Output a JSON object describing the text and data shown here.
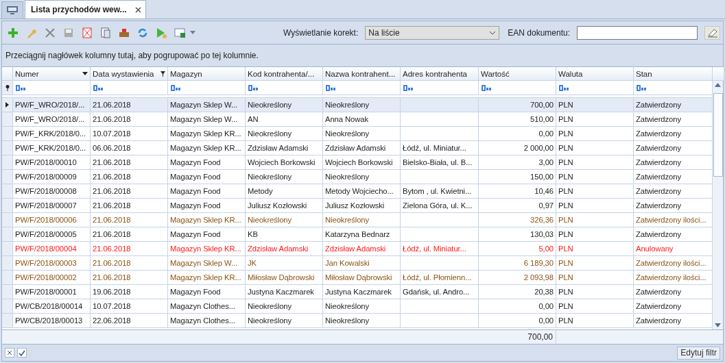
{
  "tabs": [
    {
      "label": "Lista przychodów wew...",
      "selected": true
    }
  ],
  "toolbar": {
    "corrections_label": "Wyświetlanie korekt:",
    "corrections_value": "Na liście",
    "ean_label": "EAN dokumentu:"
  },
  "group_hint": "Przeciągnij nagłówek kolumny tutaj, aby pogrupować po tej kolumnie.",
  "table": {
    "columns": [
      {
        "label": "Numer",
        "sorted": true,
        "filtered": false,
        "kind": "text"
      },
      {
        "label": "Data wystawienia",
        "sorted": false,
        "filtered": true,
        "kind": "text"
      },
      {
        "label": "Magazyn",
        "sorted": false,
        "filtered": false,
        "kind": "text"
      },
      {
        "label": "Kod kontrahenta/...",
        "sorted": false,
        "filtered": false,
        "kind": "text"
      },
      {
        "label": "Nazwa kontrahent...",
        "sorted": false,
        "filtered": false,
        "kind": "text"
      },
      {
        "label": "Adres kontrahenta",
        "sorted": false,
        "filtered": false,
        "kind": "text"
      },
      {
        "label": "Wartość",
        "sorted": false,
        "filtered": false,
        "kind": "amount"
      },
      {
        "label": "Waluta",
        "sorted": false,
        "filtered": false,
        "kind": "text"
      },
      {
        "label": "Stan",
        "sorted": false,
        "filtered": false,
        "kind": "text"
      }
    ],
    "rows": [
      {
        "selected": true,
        "kind": "normal",
        "cells": [
          "PW/F_WRO/2018/...",
          "21.06.2018",
          "Magazyn Sklep W...",
          "Nieokreślony",
          "Nieokreślony",
          "",
          "700,00",
          "PLN",
          "Zatwierdzony"
        ]
      },
      {
        "selected": false,
        "kind": "normal",
        "cells": [
          "PW/F_WRO/2018/...",
          "21.06.2018",
          "Magazyn Sklep W...",
          "AN",
          "Anna Nowak",
          "",
          "510,00",
          "PLN",
          "Zatwierdzony"
        ]
      },
      {
        "selected": false,
        "kind": "normal",
        "cells": [
          "PW/F_KRK/2018/0...",
          "10.07.2018",
          "Magazyn Sklep KR...",
          "Nieokreślony",
          "Nieokreślony",
          "",
          "0,00",
          "PLN",
          "Zatwierdzony"
        ]
      },
      {
        "selected": false,
        "kind": "normal",
        "cells": [
          "PW/F_KRK/2018/0...",
          "06.06.2018",
          "Magazyn Sklep KR...",
          "Zdzisław Adamski",
          "Zdzisław Adamski",
          "Łódź, ul. Miniatur...",
          "2 000,00",
          "PLN",
          "Zatwierdzony"
        ]
      },
      {
        "selected": false,
        "kind": "normal",
        "cells": [
          "PW/F/2018/00010",
          "21.06.2018",
          "Magazyn Food",
          "Wojciech Borkowski",
          "Wojciech Borkowski",
          "Bielsko-Biała, ul. B...",
          "3,00",
          "PLN",
          "Zatwierdzony"
        ]
      },
      {
        "selected": false,
        "kind": "normal",
        "cells": [
          "PW/F/2018/00009",
          "21.06.2018",
          "Magazyn Food",
          "Nieokreślony",
          "Nieokreślony",
          "",
          "150,00",
          "PLN",
          "Zatwierdzony"
        ]
      },
      {
        "selected": false,
        "kind": "normal",
        "cells": [
          "PW/F/2018/00008",
          "21.06.2018",
          "Magazyn Food",
          "Metody",
          "Metody Wojciecho...",
          "Bytom , ul. Kwietni...",
          "10,46",
          "PLN",
          "Zatwierdzony"
        ]
      },
      {
        "selected": false,
        "kind": "normal",
        "cells": [
          "PW/F/2018/00007",
          "21.06.2018",
          "Magazyn Food",
          "Juliusz Kozłowski",
          "Juliusz Kozłowski",
          "Zielona Góra, ul. K...",
          "0,97",
          "PLN",
          "Zatwierdzony"
        ]
      },
      {
        "selected": false,
        "kind": "partial",
        "cells": [
          "PW/F/2018/00006",
          "21.06.2018",
          "Magazyn Sklep KR...",
          "Nieokreślony",
          "Nieokreślony",
          "",
          "326,36",
          "PLN",
          "Zatwierdzony ilości..."
        ]
      },
      {
        "selected": false,
        "kind": "normal",
        "cells": [
          "PW/F/2018/00005",
          "21.06.2018",
          "Magazyn Food",
          "KB",
          "Katarzyna Bednarz",
          "",
          "130,03",
          "PLN",
          "Zatwierdzony"
        ]
      },
      {
        "selected": false,
        "kind": "cancelled",
        "cells": [
          "PW/F/2018/00004",
          "21.06.2018",
          "Magazyn Sklep KR...",
          "Zdzisław Adamski",
          "Zdzisław Adamski",
          "Łódź, ul. Miniatur...",
          "5,00",
          "PLN",
          "Anulowany"
        ]
      },
      {
        "selected": false,
        "kind": "partial",
        "cells": [
          "PW/F/2018/00003",
          "21.06.2018",
          "Magazyn Sklep W...",
          "JK",
          "Jan Kowalski",
          "",
          "6 189,30",
          "PLN",
          "Zatwierdzony ilości..."
        ]
      },
      {
        "selected": false,
        "kind": "partial",
        "cells": [
          "PW/F/2018/00002",
          "21.06.2018",
          "Magazyn Sklep KR...",
          "Miłosław Dąbrowski",
          "Miłosław Dąbrowski",
          "Łódź, ul. Płomienn...",
          "2 093,98",
          "PLN",
          "Zatwierdzony ilości..."
        ]
      },
      {
        "selected": false,
        "kind": "normal",
        "cells": [
          "PW/F/2018/00001",
          "19.06.2018",
          "Magazyn Food",
          "Justyna Kaczmarek",
          "Justyna Kaczmarek",
          "Gdańsk, ul. Andro...",
          "20,38",
          "PLN",
          "Zatwierdzony"
        ]
      },
      {
        "selected": false,
        "kind": "normal",
        "cells": [
          "PW/CB/2018/00014",
          "10.07.2018",
          "Magazyn Clothes...",
          "Nieokreślony",
          "Nieokreślony",
          "",
          "0,00",
          "PLN",
          "Zatwierdzony"
        ]
      },
      {
        "selected": false,
        "kind": "normal",
        "cells": [
          "PW/CB/2018/00013",
          "22.06.2018",
          "Magazyn Clothes...",
          "Nieokreślony",
          "Nieokreślony",
          "",
          "0,00",
          "PLN",
          "Zatwierdzony"
        ]
      }
    ],
    "summary": {
      "value": "700,00"
    }
  },
  "filter_bar": {
    "enabled": true,
    "edit_button": "Edytuj filtr"
  }
}
